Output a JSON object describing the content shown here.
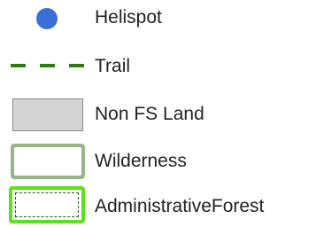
{
  "legend": {
    "items": [
      {
        "label": "Helispot",
        "symbol": "blue-dot",
        "color": "#3a6fd8"
      },
      {
        "label": "Trail",
        "symbol": "green-dashed-line",
        "color": "#2f7d12"
      },
      {
        "label": "Non FS Land",
        "symbol": "gray-fill-box",
        "color": "#d4d4d4",
        "border_color": "#8a8a8a"
      },
      {
        "label": "Wilderness",
        "symbol": "outlined-box",
        "outline_color": "#97b48a",
        "fill_color": "#ffffff"
      },
      {
        "label": "AdministrativeForest",
        "symbol": "bright-outlined-box-dashed",
        "outline_color": "#5be21d",
        "dash_color": "#2a5c12",
        "fill_color": "#ffffff"
      }
    ]
  }
}
